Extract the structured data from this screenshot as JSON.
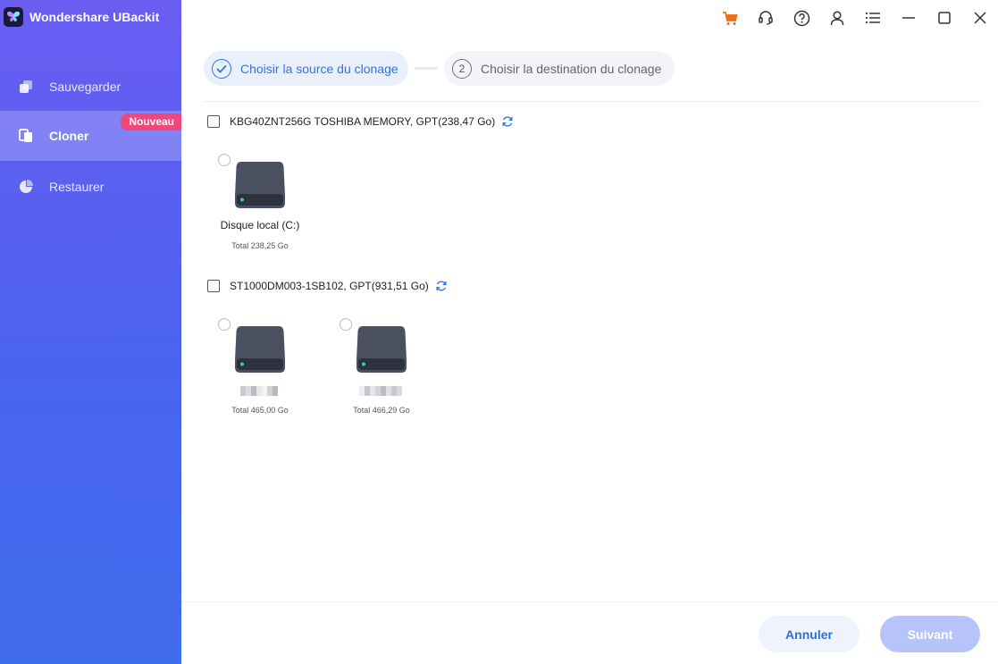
{
  "app": {
    "title": "Wondershare UBackit"
  },
  "sidebar": {
    "items": [
      {
        "label": "Sauvegarder",
        "icon": "backup-icon",
        "active": false
      },
      {
        "label": "Cloner",
        "icon": "clone-icon",
        "active": true,
        "badge": "Nouveau"
      },
      {
        "label": "Restaurer",
        "icon": "restore-icon",
        "active": false
      }
    ]
  },
  "titlebar": {
    "icons": [
      "cart-icon",
      "headset-support-icon",
      "help-icon",
      "user-icon",
      "menu-list-icon",
      "minimize-icon",
      "maximize-icon",
      "close-icon"
    ],
    "cart_color": "#f26b1d"
  },
  "steps": [
    {
      "number": "1",
      "label": "Choisir la source du clonage",
      "state": "active"
    },
    {
      "number": "2",
      "label": "Choisir la destination du clonage",
      "state": "pending"
    }
  ],
  "disks": [
    {
      "title": "KBG40ZNT256G TOSHIBA MEMORY, GPT(238,47 Go)",
      "partitions": [
        {
          "name": "Disque local (C:)",
          "size": "Total 238,25 Go",
          "name_obscured": false
        }
      ]
    },
    {
      "title": "ST1000DM003-1SB102, GPT(931,51 Go)",
      "partitions": [
        {
          "name": "",
          "size": "Total 465,00 Go",
          "name_obscured": true
        },
        {
          "name": "",
          "size": "Total 466,29 Go",
          "name_obscured": true
        }
      ]
    }
  ],
  "footer": {
    "cancel_label": "Annuler",
    "next_label": "Suivant"
  },
  "colors": {
    "accent": "#2f73e8",
    "badge": "#f0487a",
    "next_disabled": "#b7c4fb",
    "drive_body": "#4a5060",
    "drive_led": "#2fd5a0"
  }
}
